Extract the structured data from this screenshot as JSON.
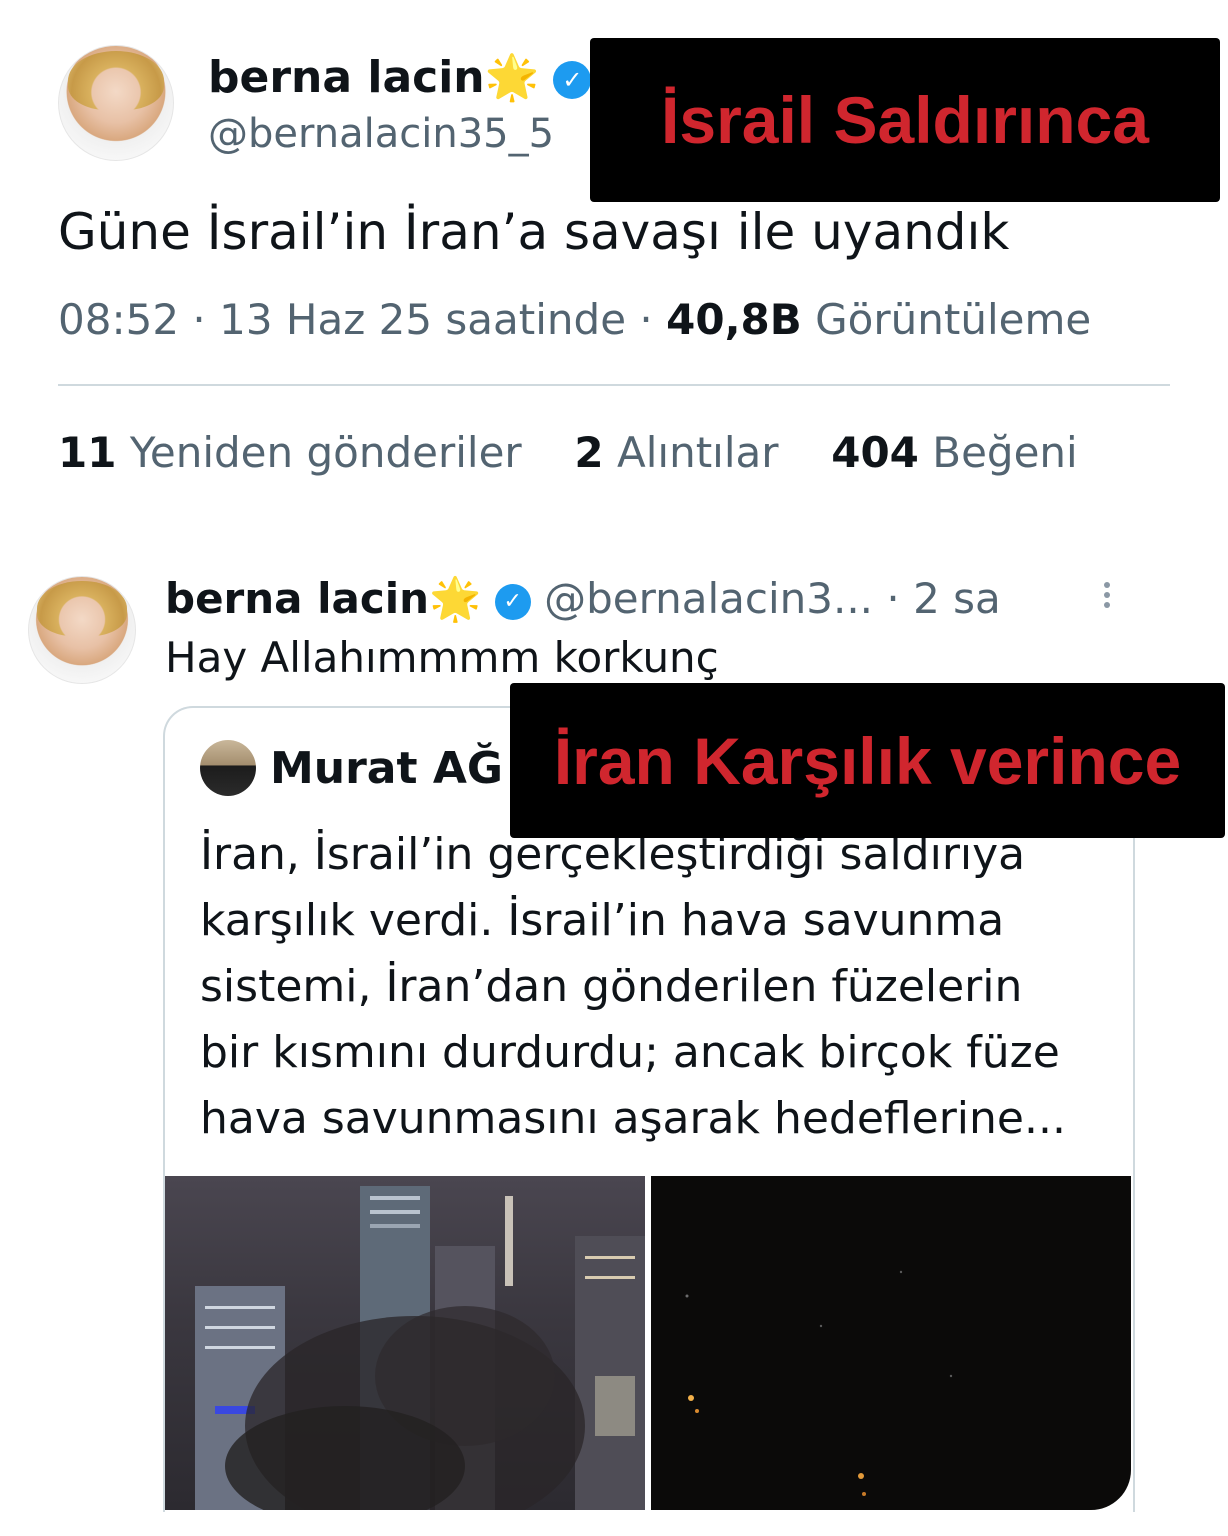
{
  "tweet1": {
    "author_name": "berna lacin",
    "star_emoji": "🌟",
    "verified_mark": "✓",
    "handle": "@bernalacin35_5",
    "text": "Güne İsrail’in İran’a savaşı ile uyandık",
    "time": "08:52",
    "date": "13 Haz 25 saatinde",
    "views_count": "40,8B",
    "views_label": "Görüntüleme",
    "retweets_count": "11",
    "retweets_label": "Yeniden gönderiler",
    "quotes_count": "2",
    "quotes_label": "Alıntılar",
    "likes_count": "404",
    "likes_label": "Beğeni"
  },
  "tweet2": {
    "author_name": "berna lacin",
    "star_emoji": "🌟",
    "verified_mark": "✓",
    "handle": "@bernalacin3...",
    "time_ago": "· 2 sa",
    "text": "Hay Allahımmmm korkunç",
    "quoted": {
      "author_name": "Murat AĞ",
      "text_lines": [
        "İran, İsrail’in gerçekleştirdiği saldırıya",
        "karşılık verdi. İsrail’in hava savunma",
        "sistemi, İran’dan gönderilen füzelerin",
        "bir kısmını durdurdu; ancak birçok füze",
        "hava savunmasını aşarak hedeflerine..."
      ]
    }
  },
  "overlays": {
    "top_caption": "İsrail Saldırınca",
    "middle_caption": "İran Karşılık verince",
    "caption_color": "#d0262e"
  },
  "colors": {
    "text": "#0f1419",
    "muted": "#536471",
    "verified": "#1d9bf0"
  }
}
